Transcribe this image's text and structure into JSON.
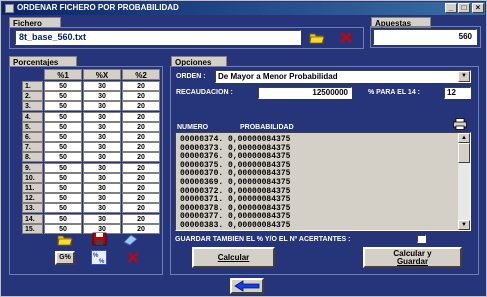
{
  "window": {
    "title": "ORDENAR FICHERO POR PROBABILIDAD",
    "min": "_",
    "max": "□",
    "close": "×"
  },
  "fichero": {
    "label": "Fichero",
    "value": "8t_base_560.txt"
  },
  "apuestas": {
    "label": "Apuestas",
    "value": "560"
  },
  "porcentajes": {
    "label": "Porcentajes",
    "headers": [
      "%1",
      "%X",
      "%2"
    ],
    "rows": [
      {
        "num": "1.",
        "v": [
          "50",
          "30",
          "20"
        ]
      },
      {
        "num": "2.",
        "v": [
          "50",
          "30",
          "20"
        ]
      },
      {
        "num": "3.",
        "v": [
          "50",
          "30",
          "20"
        ]
      },
      {
        "num": "4.",
        "v": [
          "50",
          "30",
          "20"
        ]
      },
      {
        "num": "5.",
        "v": [
          "50",
          "30",
          "20"
        ]
      },
      {
        "num": "6.",
        "v": [
          "50",
          "30",
          "20"
        ]
      },
      {
        "num": "7.",
        "v": [
          "50",
          "30",
          "20"
        ]
      },
      {
        "num": "8.",
        "v": [
          "50",
          "30",
          "20"
        ]
      },
      {
        "num": "9.",
        "v": [
          "50",
          "30",
          "20"
        ]
      },
      {
        "num": "10.",
        "v": [
          "50",
          "30",
          "20"
        ]
      },
      {
        "num": "11.",
        "v": [
          "50",
          "30",
          "20"
        ]
      },
      {
        "num": "12.",
        "v": [
          "50",
          "30",
          "20"
        ]
      },
      {
        "num": "13.",
        "v": [
          "50",
          "30",
          "20"
        ]
      },
      {
        "num": "14.",
        "v": [
          "50",
          "30",
          "20"
        ]
      },
      {
        "num": "15.",
        "v": [
          "50",
          "30",
          "20"
        ]
      }
    ],
    "gpct_label": "G%"
  },
  "opciones": {
    "label": "Opciones",
    "orden_label": "ORDEN :",
    "orden_value": "De Mayor a Menor Probabilidad",
    "recaudacion_label": "RECAUDACION :",
    "recaudacion_value": "12500000",
    "pct14_label": "% PARA EL 14 :",
    "pct14_value": "12",
    "col_numero": "NUMERO",
    "col_prob": "PROBABILIDAD",
    "results": [
      "00000374.  0,00000084375",
      "00000373.  0,00000084375",
      "00000376.  0,00000084375",
      "00000375.  0,00000084375",
      "00000370.  0,00000084375",
      "00000369.  0,00000084375",
      "00000372.  0,00000084375",
      "00000371.  0,00000084375",
      "00000378.  0,00000084375",
      "00000377.  0,00000084375",
      "00000383.  0,00000084375"
    ],
    "guardar_label": "GUARDAR TAMBIEN EL % Y/O EL Nº ACERTANTES :",
    "calcular": "Calcular",
    "calcular_guardar_1": "Calcular y",
    "calcular_guardar_2": "Guardar"
  },
  "colors": {
    "background": "#26357a",
    "accent": "#0a246a",
    "delete": "#d00000",
    "folder": "#e8c800"
  }
}
